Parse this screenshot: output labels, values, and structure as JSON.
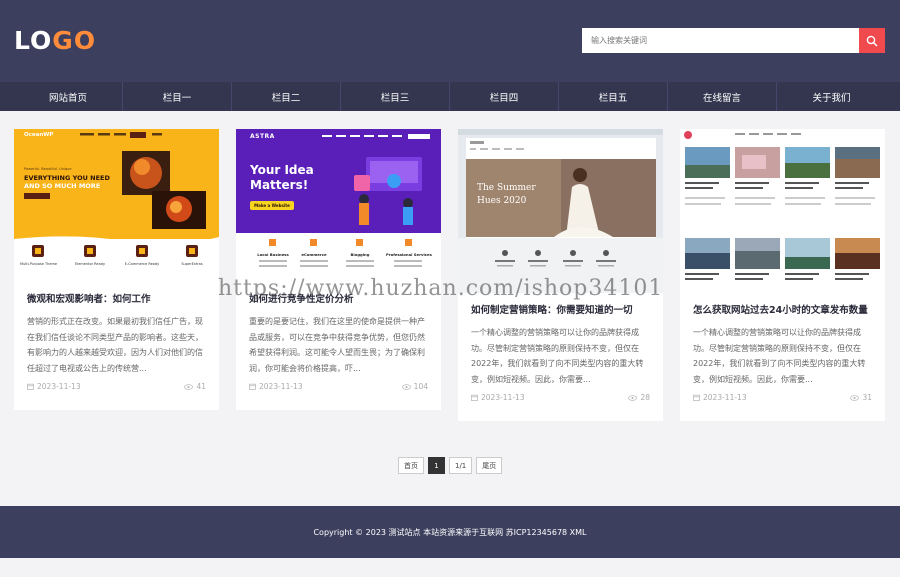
{
  "header": {
    "logo": {
      "part1": "LO",
      "part2": "G",
      "part3": "O"
    },
    "search": {
      "placeholder": "输入搜索关键词"
    }
  },
  "nav": {
    "items": [
      {
        "label": "网站首页"
      },
      {
        "label": "栏目一"
      },
      {
        "label": "栏目二"
      },
      {
        "label": "栏目三"
      },
      {
        "label": "栏目四"
      },
      {
        "label": "栏目五"
      },
      {
        "label": "在线留言"
      },
      {
        "label": "关于我们"
      }
    ]
  },
  "cards": [
    {
      "title": "微观和宏观影响者：如何工作",
      "excerpt": "营销的形式正在改变。如果最初我们信任广告，现在我们信任谈论不同类型产品的影响者。这些天，有影响力的人越来越受欢迎，因为人们对他们的信任超过了电视或公告上的传统营...",
      "date": "2023-11-13",
      "views": "41",
      "thumb": {
        "brand": "OceanWP",
        "tagline": "Powerful. Beautiful. Unique",
        "headline1": "EVERYTHING YOU NEED",
        "headline2": "AND SO MUCH MORE",
        "features": [
          "Multi-Purpose Theme",
          "Elementor Ready",
          "E-Commerce Ready",
          "SuperExtras"
        ]
      }
    },
    {
      "title": "如何进行竞争性定价分析",
      "excerpt": "重要的是要记住，我们在这里的使命是提供一种产品或服务，可以在竞争中获得竞争优势，但您仍然希望获得利润。这可能令人望而生畏；为了确保利润，你可能会将价格提高，吓...",
      "date": "2023-11-13",
      "views": "104",
      "thumb": {
        "brand": "ASTRA",
        "headline1": "Your Idea",
        "headline2": "Matters!",
        "cta": "Make a Website",
        "features": [
          "Local Business",
          "eCommerce",
          "Blogging",
          "Professional Services"
        ]
      }
    },
    {
      "title": "如何制定营销策略：你需要知道的一切",
      "excerpt": "一个精心调整的营销策略可以让你的品牌获得成功。尽管制定营销策略的原则保持不变，但仅在2022年，我们就看到了向不同类型内容的重大转变，例如短视频。因此，你需要...",
      "date": "2023-11-13",
      "views": "28",
      "thumb": {
        "headline1": "The Summer",
        "headline2": "Hues 2020"
      }
    },
    {
      "title": "怎么获取网站过去24小时的文章发布数量",
      "excerpt": "一个精心调整的营销策略可以让你的品牌获得成功。尽管制定营销策略的原则保持不变，但仅在2022年，我们就看到了向不同类型内容的重大转变，例如短视频。因此，你需要...",
      "date": "2023-11-13",
      "views": "31",
      "thumb": {}
    }
  ],
  "pagination": {
    "first": "首页",
    "current": "1",
    "total": "1/1",
    "last": "尾页"
  },
  "footer": {
    "text": "Copyright © 2023 测试站点 本站资源来源于互联网 苏ICP12345678 XML"
  },
  "watermark": "https://www.huzhan.com/ishop34101",
  "colors": {
    "header_bg": "#3d3f5e",
    "nav_bg": "#34364f",
    "accent": "#f04a4f",
    "logo_accent": "#ff8c3a",
    "page_bg": "#f3f3f5"
  }
}
